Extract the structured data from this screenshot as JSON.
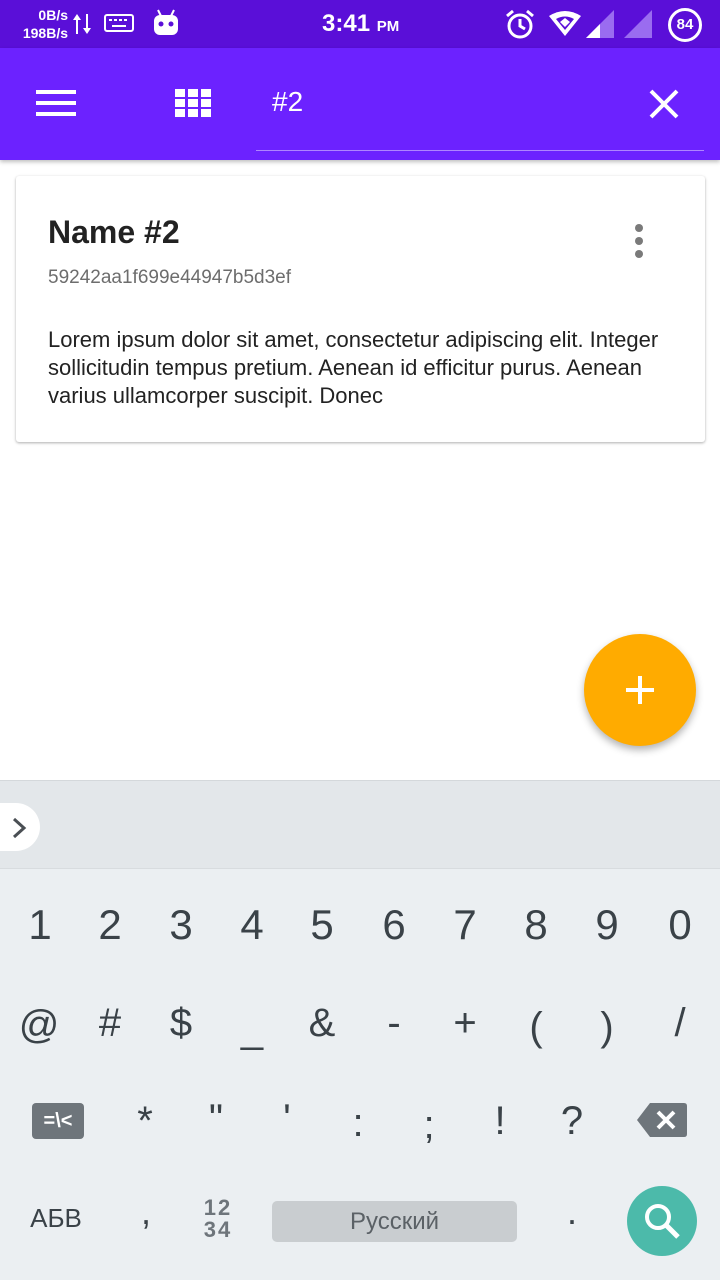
{
  "status_bar": {
    "net_down": "0B/s",
    "net_up": "198B/s",
    "time": "3:41",
    "ampm": "PM",
    "battery": "84",
    "icons": [
      "data-arrows-icon",
      "keyboard-icon",
      "android-icon",
      "alarm-icon",
      "wifi-icon",
      "signal-icon",
      "battery-icon"
    ]
  },
  "app_bar": {
    "background": "#6c22ff",
    "search_value": "#2",
    "icons": [
      "menu-icon",
      "grid-icon",
      "close-icon"
    ]
  },
  "card": {
    "title": "Name #2",
    "id": "59242aa1f699e44947b5d3ef",
    "body": "Lorem ipsum dolor sit amet, consectetur adipiscing elit. Integer sollicitudin tempus pretium. Aenean id efficitur purus. Aenean varius ullamcorper suscipit. Donec"
  },
  "fab": {
    "color": "#ffab00",
    "icon": "plus-icon"
  },
  "keyboard": {
    "row1": [
      "1",
      "2",
      "3",
      "4",
      "5",
      "6",
      "7",
      "8",
      "9",
      "0"
    ],
    "row2": [
      "@",
      "#",
      "$",
      "_",
      "&",
      "-",
      "+",
      "(",
      ")",
      "/"
    ],
    "switch_label": "=\\<",
    "row3": [
      "*",
      "\"",
      "'",
      ":",
      ";",
      "!",
      "?"
    ],
    "abc_label": "АБВ",
    "comma": ",",
    "num_top": "12",
    "num_bottom": "34",
    "space_label": "Русский",
    "dot": ".",
    "search_color": "#4cbaaa"
  }
}
